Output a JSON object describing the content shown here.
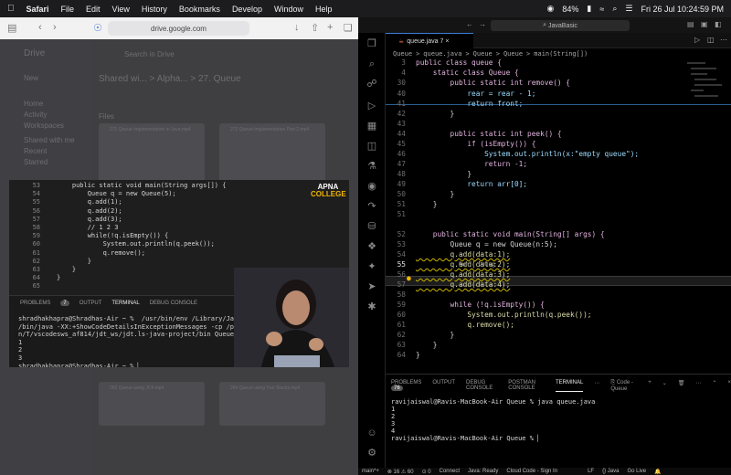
{
  "menubar": {
    "apple": "",
    "app": "Safari",
    "items": [
      "File",
      "Edit",
      "View",
      "History",
      "Bookmarks",
      "Develop",
      "Window",
      "Help"
    ],
    "battery": "84%",
    "datetime": "Fri 26 Jul  10:24:59 PM"
  },
  "safari": {
    "address": "drive.google.com",
    "drive": {
      "logo": "Drive",
      "search": "Search in Drive",
      "new_label": "New",
      "nav": [
        "Home",
        "Activity",
        "Workspaces",
        "Shared with me",
        "Recent",
        "Starred"
      ],
      "breadcrumb": "Shared wi...  >  Alpha...  >  27. Queue",
      "section_label": "Files",
      "cards": [
        "271 Queue Implementation in Java.mp4",
        "272 Queue Implementation Part 2.mp4",
        "282 Queue using JCF.mp4",
        "284 Queue using Two Stacks.mp4"
      ]
    }
  },
  "video": {
    "lines": [
      {
        "n": "53",
        "t": "    public static void main(String args[]) {"
      },
      {
        "n": "54",
        "t": "        Queue q = new Queue(5);"
      },
      {
        "n": "55",
        "t": "        q.add(1);"
      },
      {
        "n": "56",
        "t": "        q.add(2);"
      },
      {
        "n": "57",
        "t": "        q.add(3);"
      },
      {
        "n": "58",
        "t": "        // 1 2 3"
      },
      {
        "n": "59",
        "t": "        while(!q.isEmpty()) {"
      },
      {
        "n": "60",
        "t": "            System.out.println(q.peek());"
      },
      {
        "n": "61",
        "t": "            q.remove();"
      },
      {
        "n": "62",
        "t": "        }"
      },
      {
        "n": "63",
        "t": "    }"
      },
      {
        "n": "64",
        "t": "}"
      },
      {
        "n": "65",
        "t": ""
      }
    ],
    "logo_line1": "APNA",
    "logo_line2": "COLLEGE",
    "panel_tabs": [
      "PROBLEMS",
      "7",
      "OUTPUT",
      "TERMINAL",
      "DEBUG CONSOLE"
    ],
    "console_label": "onsole",
    "terminal": "shradhakhapra@Shradhas-Air ~ %  /usr/bin/env /Library/Java/JavaVirt          0.1.jdk/\n/bin/java -XX:+ShowCodeDetailsInExceptionMessages -cp /private/va          2szp\nn/T/vscodesws_af814/jdt_ws/jdt.ls-java-project/bin QueueB\n1\n2\n3\nshradhakhapra@Shradhas-Air ~ % ▏"
  },
  "vscode": {
    "title": "JavaBasic",
    "tab": {
      "label": "queue.java",
      "count": "7"
    },
    "breadcrumb": [
      "Queue",
      ">",
      "queue.java",
      ">",
      "Queue",
      ">",
      "Queue",
      ">",
      "main(String[])"
    ],
    "lines": [
      {
        "n": "3",
        "t": "public class queue {"
      },
      {
        "n": "4",
        "t": "    static class Queue {"
      },
      {
        "n": "30",
        "t": "        public static int remove() {"
      },
      {
        "n": "40",
        "t": "            rear = rear - 1;"
      },
      {
        "n": "41",
        "t": "            return front;"
      },
      {
        "n": "42",
        "t": "        }"
      },
      {
        "n": "43",
        "t": ""
      },
      {
        "n": "44",
        "t": "        public static int peek() {"
      },
      {
        "n": "45",
        "t": "            if (isEmpty()) {"
      },
      {
        "n": "46",
        "t": "                System.out.println(x:\"empty queue\");"
      },
      {
        "n": "47",
        "t": "                return -1;"
      },
      {
        "n": "48",
        "t": "            }"
      },
      {
        "n": "49",
        "t": "            return arr[0];"
      },
      {
        "n": "50",
        "t": "        }"
      },
      {
        "n": "51",
        "t": "    }"
      },
      {
        "n": "51",
        "t": ""
      },
      {
        "n": "52",
        "t": "    public static void main(String[] args) {"
      },
      {
        "n": "53",
        "t": "        Queue q = new Queue(n:5);"
      },
      {
        "n": "54",
        "t": "        q.add(data:1);"
      },
      {
        "n": "55",
        "t": "        q.add(data:2);"
      },
      {
        "n": "56",
        "t": "        q.add(data:3);"
      },
      {
        "n": "57",
        "t": "        q.add(data:4);"
      },
      {
        "n": "58",
        "t": ""
      },
      {
        "n": "59",
        "t": "        while (!q.isEmpty()) {"
      },
      {
        "n": "60",
        "t": "            System.out.println(q.peek());"
      },
      {
        "n": "61",
        "t": "            q.remove();"
      },
      {
        "n": "62",
        "t": "        }"
      },
      {
        "n": "63",
        "t": "    }"
      },
      {
        "n": "64",
        "t": "}"
      }
    ],
    "codelens": "Run | Debug",
    "panel": {
      "tabs": [
        "PROBLEMS",
        "76",
        "OUTPUT",
        "DEBUG CONSOLE",
        "POSTMAN CONSOLE",
        "TERMINAL"
      ],
      "terminal_name": "Code - Queue",
      "terminal": "ravijaiswal@Ravis-MacBook-Air Queue % java queue.java\n1\n2\n3\n4\nravijaiswal@Ravis-MacBook-Air Queue % ▏"
    },
    "statusbar": [
      "main*+",
      "⊗ 16 ⚠ 60",
      "⊙ 0",
      "Connect",
      "Java: Ready",
      "Cloud Code - Sign In",
      "LF",
      "{} Java",
      "Go Live"
    ]
  }
}
